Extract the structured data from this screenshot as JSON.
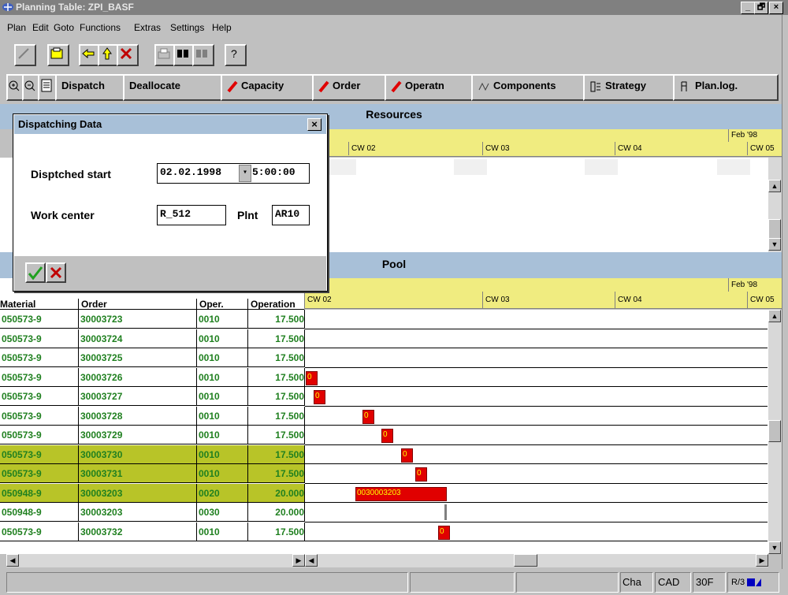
{
  "window": {
    "title": "Planning Table: ZPI_BASF",
    "controls": [
      "_",
      "🗗",
      "×"
    ]
  },
  "menu": [
    "Plan",
    "Edit",
    "Goto",
    "Functions",
    "Extras",
    "Settings",
    "Help"
  ],
  "app_toolbar": {
    "buttons": [
      "Dispatch",
      "Deallocate",
      "Capacity",
      "Order",
      "Operatn",
      "Components",
      "Strategy",
      "Plan.log."
    ]
  },
  "resources_panel": {
    "title": "Resources",
    "month": "Feb '98",
    "weeks": [
      "CW 02",
      "CW 03",
      "CW 04",
      "CW 05"
    ]
  },
  "pool_panel": {
    "title": "Pool",
    "month": "Feb '98",
    "weeks": [
      "CW 02",
      "CW 03",
      "CW 04",
      "CW 05"
    ],
    "columns": [
      "Material",
      "Order",
      "Oper.",
      "Operation"
    ],
    "rows": [
      {
        "material": "050573-9",
        "order": "30003723",
        "oper": "0010",
        "operation": "17.500",
        "highlight": false
      },
      {
        "material": "050573-9",
        "order": "30003724",
        "oper": "0010",
        "operation": "17.500",
        "highlight": false
      },
      {
        "material": "050573-9",
        "order": "30003725",
        "oper": "0010",
        "operation": "17.500",
        "highlight": false
      },
      {
        "material": "050573-9",
        "order": "30003726",
        "oper": "0010",
        "operation": "17.500",
        "highlight": false
      },
      {
        "material": "050573-9",
        "order": "30003727",
        "oper": "0010",
        "operation": "17.500",
        "highlight": false
      },
      {
        "material": "050573-9",
        "order": "30003728",
        "oper": "0010",
        "operation": "17.500",
        "highlight": false
      },
      {
        "material": "050573-9",
        "order": "30003729",
        "oper": "0010",
        "operation": "17.500",
        "highlight": false
      },
      {
        "material": "050573-9",
        "order": "30003730",
        "oper": "0010",
        "operation": "17.500",
        "highlight": true
      },
      {
        "material": "050573-9",
        "order": "30003731",
        "oper": "0010",
        "operation": "17.500",
        "highlight": true
      },
      {
        "material": "050948-9",
        "order": "30003203",
        "oper": "0020",
        "operation": "20.000",
        "highlight": true
      },
      {
        "material": "050948-9",
        "order": "30003203",
        "oper": "0030",
        "operation": "20.000",
        "highlight": false
      },
      {
        "material": "050573-9",
        "order": "30003732",
        "oper": "0010",
        "operation": "17.500",
        "highlight": false
      }
    ],
    "bar_labels": {
      "small": "0",
      "large": "0030003203"
    }
  },
  "dialog": {
    "title": "Dispatching Data",
    "start_label": "Disptched start",
    "start_date": "02.02.1998",
    "start_time": "5:00:00",
    "workcenter_label": "Work center",
    "workcenter_value": "R_512",
    "plant_label": "Plnt",
    "plant_value": "AR10"
  },
  "statusbar": {
    "fields": [
      "Cha",
      "CAD",
      "30F",
      "R/3"
    ]
  },
  "colors": {
    "accent_blue": "#a8c0d8",
    "week_yellow": "#f0ec80",
    "row_highlight": "#b8c428",
    "text_green": "#208020",
    "bar_red": "#e00000"
  }
}
